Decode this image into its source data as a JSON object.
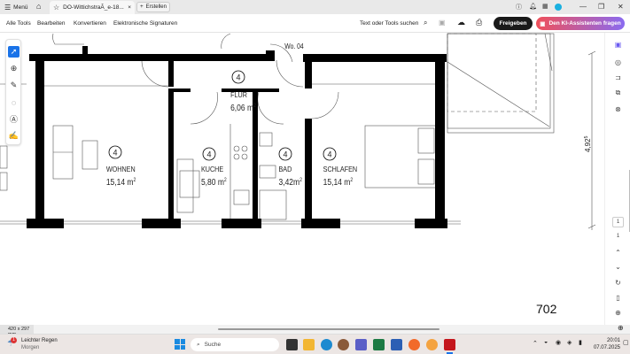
{
  "titlebar": {
    "menu_label": "Menü",
    "tab_title": "DO-WittichstraÃ_e-18...",
    "new_label": "Erstellen"
  },
  "toolbar": {
    "items": [
      "Alle Tools",
      "Bearbeiten",
      "Konvertieren",
      "Elektronische Signaturen"
    ],
    "search_label": "Text oder Tools suchen",
    "share_label": "Freigeben",
    "ai_label": "Den KI-Assistenten fragen"
  },
  "plan": {
    "unit_label": "Wo. 04",
    "rooms": [
      {
        "number": "4",
        "name": "WOHNEN",
        "area": "15,14 m",
        "sup": "2"
      },
      {
        "number": "4",
        "name": "FLUR",
        "area": "6,06 m",
        "sup": "2"
      },
      {
        "number": "4",
        "name": "KUCHE",
        "area": "5,80 m",
        "sup": "2"
      },
      {
        "number": "4",
        "name": "BAD",
        "area": "3,42m",
        "sup": "2"
      },
      {
        "number": "4",
        "name": "SCHLAFEN",
        "area": "15,14 m",
        "sup": "2"
      }
    ],
    "dimension": "4,92",
    "dimension_sup": "5",
    "page_label": "702"
  },
  "sidebar": {
    "page_current": "1",
    "page_total": "1"
  },
  "status": {
    "page_size": "420 x 297 mm"
  },
  "taskbar": {
    "weather_title": "Leichter Regen",
    "weather_sub": "Morgen",
    "weather_badge": "1",
    "search_placeholder": "Suche",
    "time": "20:01",
    "date": "07.07.2025"
  },
  "colors": {
    "ai_gradient_start": "#f0505a",
    "ai_gradient_end": "#8a6bf0",
    "active_tool": "#1a73e8",
    "share_bg": "#1a1a1a"
  }
}
